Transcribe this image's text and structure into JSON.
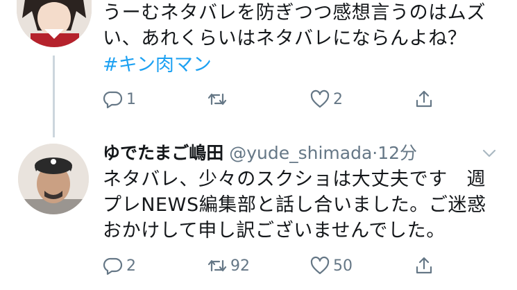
{
  "tweet1": {
    "text_lines": [
      "うーむネタバレを防ぎつつ感想言うのはムズ",
      "い、あれくらいはネタバレにならんよね？"
    ],
    "hashtag": "#キン肉マン",
    "reply_count": "1",
    "retweet_count": "",
    "like_count": "2"
  },
  "tweet2": {
    "display_name": "ゆでたまご嶋田",
    "handle": "@yude_shimada",
    "separator": "·",
    "time": "12分",
    "text_lines": [
      "ネタバレ、少々のスクショは大丈夫です　週",
      "プレNEWS編集部と話し合いました。ご迷惑",
      "おかけして申し訳ございませんでした。"
    ],
    "reply_count": "2",
    "retweet_count": "92",
    "like_count": "50"
  },
  "icons": {
    "reply": "reply-icon",
    "retweet": "retweet-icon",
    "like": "heart-icon",
    "share": "share-icon",
    "menu": "chevron-down-icon"
  },
  "colors": {
    "accent": "#1da1f2",
    "muted": "#657786",
    "thread_line": "#ccd6dd"
  }
}
